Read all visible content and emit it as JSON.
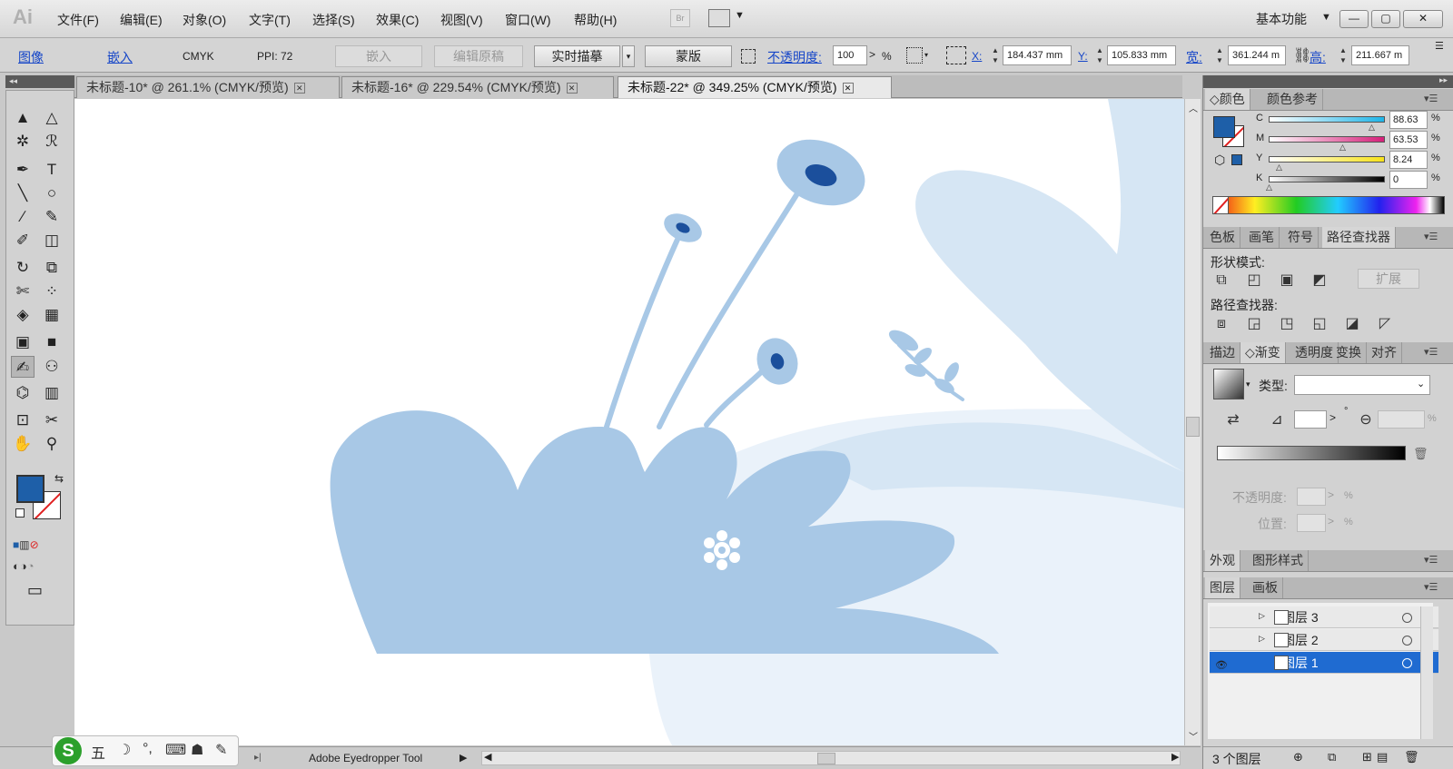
{
  "app": {
    "logo": "Ai"
  },
  "menu": [
    "文件(F)",
    "编辑(E)",
    "对象(O)",
    "文字(T)",
    "选择(S)",
    "效果(C)",
    "视图(V)",
    "窗口(W)",
    "帮助(H)"
  ],
  "top_right": {
    "bridge": "Br",
    "workspace": "基本功能",
    "workspace_arrow": "▼",
    "minimize": "—",
    "maximize": "▢",
    "close": "✕"
  },
  "control_bar": {
    "image_label": "图像",
    "embed_link": "嵌入",
    "color_mode": "CMYK",
    "ppi": "PPI: 72",
    "embed_button": "嵌入",
    "edit_original_button": "编辑原稿",
    "live_trace_button": "实时描摹",
    "mask_button": "蒙版",
    "opacity_label": "不透明度:",
    "opacity_value": "100",
    "opacity_unit": "%",
    "x_label": "X:",
    "x_value": "184.437 mm",
    "y_label": "Y:",
    "y_value": "105.833 mm",
    "w_label": "宽:",
    "w_value": "361.244 m",
    "h_label": "高:",
    "h_value": "211.667 m"
  },
  "doc_tabs": [
    {
      "label": "未标题-10* @ 261.1% (CMYK/预览)",
      "active": false
    },
    {
      "label": "未标题-16* @ 229.54% (CMYK/预览)",
      "active": false
    },
    {
      "label": "未标题-22* @ 349.25% (CMYK/预览)",
      "active": true
    }
  ],
  "tab_close": "✕",
  "tools": [
    [
      "▲",
      "△"
    ],
    [
      "✲",
      "ℛ"
    ],
    [
      "✒",
      "T"
    ],
    [
      "╲",
      "○"
    ],
    [
      "∕",
      "✎"
    ],
    [
      "✐",
      "◫"
    ],
    [
      "↻",
      "⧉"
    ],
    [
      "✄",
      "⁘"
    ],
    [
      "◈",
      "▦"
    ],
    [
      "▣",
      "■"
    ],
    [
      "✍",
      "⚇"
    ],
    [
      "⌬",
      "▥"
    ],
    [
      "⊡",
      "✂"
    ],
    [
      "✋",
      "⚲"
    ]
  ],
  "tool_modes": [
    "■",
    "▥",
    "⊘"
  ],
  "draw_modes": [
    "◐",
    "◑",
    "◔"
  ],
  "screen_mode": "▭",
  "colors": {
    "fill": "#1e5fa8",
    "accent": "#1f6bd1",
    "shape_dark": "#a8c8e6",
    "shape_light": "#d6e6f4",
    "bg_light": "#eaf2fa",
    "flower_center": "#1b4f9c"
  },
  "status": {
    "tool_name": "Adobe Eyedropper Tool",
    "arrow": "▶",
    "left": "◀",
    "right": "▶"
  },
  "ime": {
    "logo": "S",
    "items": [
      "五",
      "☽",
      "°,",
      "⌨",
      "☗",
      "✎"
    ]
  },
  "color_panel": {
    "tabs": [
      "◇颜色",
      "颜色参考"
    ],
    "menu": "▾☰",
    "channels": [
      {
        "name": "C",
        "value": "88.63",
        "unit": "%"
      },
      {
        "name": "M",
        "value": "63.53",
        "unit": "%"
      },
      {
        "name": "Y",
        "value": "8.24",
        "unit": "%"
      },
      {
        "name": "K",
        "value": "0",
        "unit": "%"
      }
    ]
  },
  "pathfinder_panel": {
    "tabs": [
      "色板",
      "画笔",
      "符号",
      "路径查找器"
    ],
    "menu": "▾☰",
    "shape_modes_label": "形状模式:",
    "expand_button": "扩展",
    "pathfinders_label": "路径查找器:"
  },
  "gradient_panel": {
    "tabs": [
      "描边",
      "◇渐变",
      "透明度",
      "变换",
      "对齐"
    ],
    "menu": "▾☰",
    "type_label": "类型:",
    "opacity_label": "不透明度:",
    "position_label": "位置:",
    "unit": "%",
    "degree": "°"
  },
  "appearance_panel": {
    "tabs": [
      "外观",
      "图形样式"
    ],
    "menu": "▾☰"
  },
  "layers_panel": {
    "tabs": [
      "图层",
      "画板"
    ],
    "menu": "▾☰",
    "layers": [
      {
        "name": "图层 3",
        "selected": false
      },
      {
        "name": "图层 2",
        "selected": false
      },
      {
        "name": "图层 1",
        "selected": true
      }
    ],
    "footer": "3 个图层"
  }
}
